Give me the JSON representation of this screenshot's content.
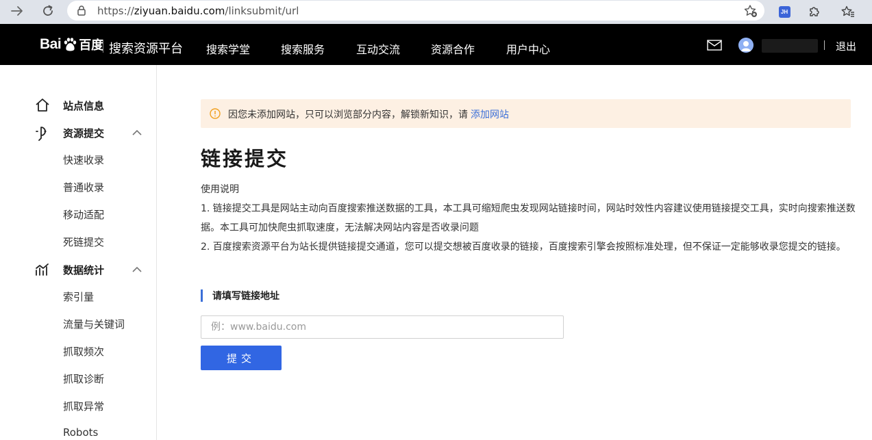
{
  "browser": {
    "url_prefix": "https://",
    "url_domain": "ziyuan.baidu.com",
    "url_path": "/linksubmit/url",
    "extension_badge": "JH"
  },
  "header": {
    "logo_text": "Bai",
    "logo_text2": "百度",
    "platform_name": "搜索资源平台",
    "nav": [
      "搜索学堂",
      "搜索服务",
      "互动交流",
      "资源合作",
      "用户中心"
    ],
    "logout": "退出"
  },
  "sidebar": {
    "site_info": "站点信息",
    "resource_submit": "资源提交",
    "resource_items": [
      "快速收录",
      "普通收录",
      "移动适配",
      "死链提交"
    ],
    "data_stats": "数据统计",
    "stats_items": [
      "索引量",
      "流量与关键词",
      "抓取频次",
      "抓取诊断",
      "抓取异常",
      "Robots"
    ]
  },
  "main": {
    "notice_text": "因您未添加网站，只可以浏览部分内容，解锁新知识，请",
    "notice_link": "添加网站",
    "title": "链接提交",
    "usage_title": "使用说明",
    "usage_lines": [
      "1. 链接提交工具是网站主动向百度搜索推送数据的工具，本工具可缩短爬虫发现网站链接时间，网站时效性内容建议使用链接提交工具，实时向搜索推送数",
      "据。本工具可加快爬虫抓取速度，无法解决网站内容是否收录问题",
      "2. 百度搜索资源平台为站长提供链接提交通道，您可以提交想被百度收录的链接，百度搜索引擎会按照标准处理，但不保证一定能够收录您提交的链接。"
    ],
    "field_label": "请填写链接地址",
    "input_placeholder": "例：www.baidu.com",
    "input_value": "",
    "submit_label": "提交"
  },
  "colors": {
    "topbar_bg": "#000000",
    "accent_blue": "#3166e3",
    "notice_bg": "#fdf0e3",
    "notice_icon": "#f0a020"
  }
}
